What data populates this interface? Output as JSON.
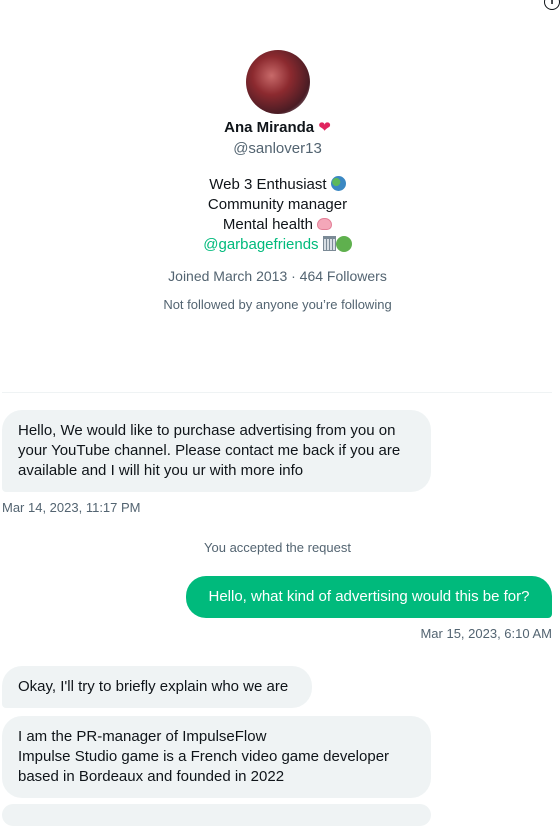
{
  "profile": {
    "name": "Ana Miranda",
    "heart": "❤",
    "handle": "@sanlover13",
    "bio_line1": "Web 3 Enthusiast",
    "bio_line2": "Community manager",
    "bio_line3": "Mental health",
    "bio_link": "@garbagefriends",
    "joined_followers": "Joined March 2013 · 464 Followers",
    "followed_by": "Not followed by anyone you’re following",
    "icons": [
      "info-icon",
      "globe-emoji",
      "brain-emoji",
      "wastebasket-emoji",
      "green-circle-emoji"
    ]
  },
  "messages": [
    {
      "direction": "incoming",
      "text": "Hello, We would like to purchase advertising from you on your YouTube channel. Please contact me back if you are available and I will hit you ur with more info",
      "timestamp": "Mar 14, 2023, 11:17 PM"
    },
    {
      "direction": "system",
      "text": "You accepted the request"
    },
    {
      "direction": "outgoing",
      "text": "Hello, what kind of advertising would this be for?",
      "timestamp": "Mar 15, 2023, 6:10 AM"
    },
    {
      "direction": "incoming",
      "text": "Okay, I'll try to briefly explain who we are"
    },
    {
      "direction": "incoming",
      "text_line1": "I am the PR-manager of ImpulseFlow",
      "text_line2": "Impulse Studio game is a French video game developer based in Bordeaux and founded in 2022"
    }
  ],
  "colors": {
    "accent": "#00ba7c",
    "incoming_bubble": "#eff3f4",
    "secondary_text": "#536471"
  }
}
